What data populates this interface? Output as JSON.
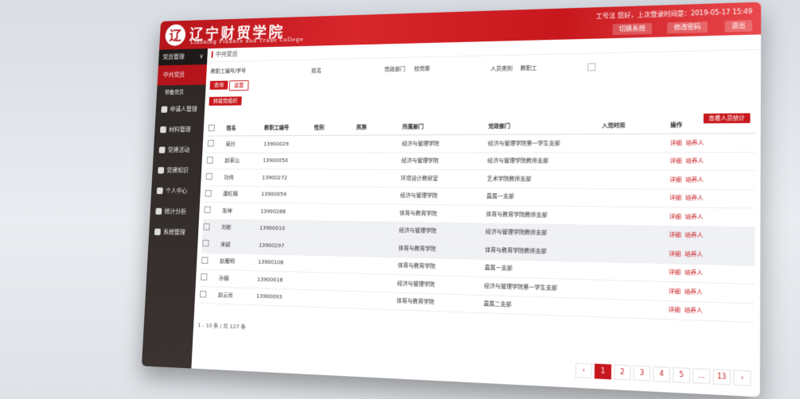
{
  "header": {
    "brand": "辽宁财贸学院",
    "brand_sub": "Liaoning Finance and Trade College",
    "user_info": "工号法 您好，上次登录时间是：2019-05-17 15:49",
    "buttons": [
      "切换系统",
      "修改密码",
      "退出"
    ]
  },
  "sidebar": {
    "head": "党员管理",
    "items": [
      {
        "label": "中共党员",
        "active": true,
        "sub": false
      },
      {
        "label": "预备党员",
        "active": false,
        "sub": true
      },
      {
        "label": "申请人管理",
        "active": false,
        "sub": false
      },
      {
        "label": "材料管理",
        "active": false,
        "sub": false
      },
      {
        "label": "党建活动",
        "active": false,
        "sub": false
      },
      {
        "label": "党建知识",
        "active": false,
        "sub": false
      },
      {
        "label": "个人中心",
        "active": false,
        "sub": false
      },
      {
        "label": "统计分析",
        "active": false,
        "sub": false
      },
      {
        "label": "系统管理",
        "active": false,
        "sub": false
      }
    ]
  },
  "breadcrumb": "中共党员",
  "filters": {
    "staff_id_label": "教职工编号/学号",
    "name_label": "姓名",
    "party_dept_label": "党政部门",
    "party_dept_value": "校党委",
    "person_type_label": "人员类别",
    "person_type_value": "教职工",
    "search_btn": "查询",
    "reset_btn": "重置",
    "add_btn": "转接党组织"
  },
  "stats_btn": "查看人员统计",
  "table": {
    "headers": [
      "姓名",
      "教职工编号",
      "性别",
      "民族",
      "所属部门",
      "党政部门",
      "入党时间",
      "操作"
    ],
    "rows": [
      {
        "name": "吴玲",
        "id": "13900029",
        "dept": "经济与管理学院",
        "party": "经济与管理学院第一学生支部"
      },
      {
        "name": "赵家山",
        "id": "13900050",
        "dept": "经济与管理学院",
        "party": "经济与管理学院教师支部"
      },
      {
        "name": "功伟",
        "id": "13900272",
        "dept": "环境设计教研室",
        "party": "艺术学院教师支部"
      },
      {
        "name": "康虹楠",
        "id": "13900059",
        "dept": "经济与管理学院",
        "party": "直属一支部"
      },
      {
        "name": "张坤",
        "id": "13900286",
        "dept": "体育与教育学院",
        "party": "体育与教育学院教师支部"
      },
      {
        "name": "刘彬",
        "id": "13900010",
        "dept": "经济与管理学院",
        "party": "经济与管理学院教师支部"
      },
      {
        "name": "宋颖",
        "id": "13900297",
        "dept": "体育与教育学院",
        "party": "体育与教育学院教师支部"
      },
      {
        "name": "赵雁明",
        "id": "13900106",
        "dept": "体育与教育学院",
        "party": "直属一支部"
      },
      {
        "name": "孙楠",
        "id": "13900016",
        "dept": "经济与管理学院",
        "party": "经济与管理学院第一学生支部"
      },
      {
        "name": "赵云尚",
        "id": "13900093",
        "dept": "体育与教育学院",
        "party": "直属二支部"
      }
    ],
    "op_detail": "详细",
    "op_train": "培养人"
  },
  "count_text": "1 - 10 条 / 共 127 条",
  "pager": [
    "‹",
    "1",
    "2",
    "3",
    "4",
    "5",
    "...",
    "13",
    "›"
  ]
}
